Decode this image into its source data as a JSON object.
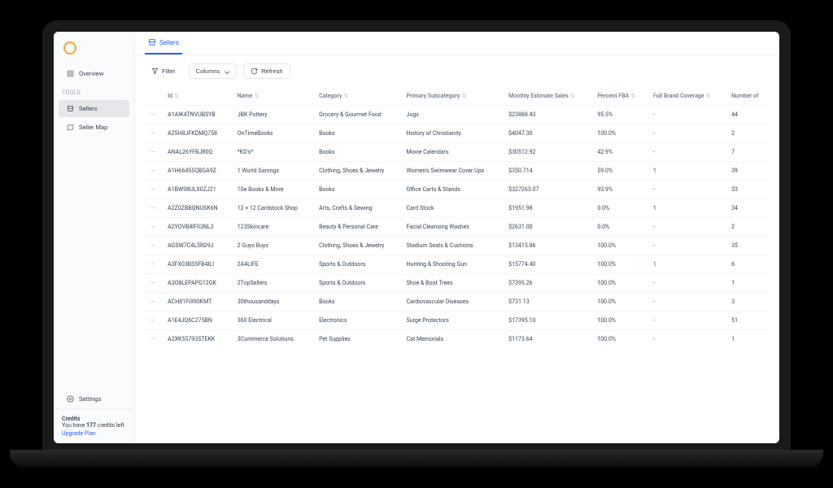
{
  "sidebar": {
    "overview": "Overview",
    "tools_label": "TOOLS",
    "sellers": "Sellers",
    "seller_map": "Seller Map",
    "settings": "Settings"
  },
  "credits": {
    "title": "Credits",
    "line_prefix": "You have ",
    "count": "177",
    "line_suffix": " credits left",
    "upgrade": "Upgrade Plan"
  },
  "tab": {
    "label": "Sellers"
  },
  "toolbar": {
    "filter": "Filter",
    "columns": "Columns",
    "refresh": "Refresh"
  },
  "columns": {
    "id": "Id",
    "name": "Name",
    "category": "Category",
    "subcat": "Primary Subcategory",
    "sales": "Monthly Estimate Sales",
    "fba": "Percent FBA",
    "brand": "Full Brand Coverage",
    "num": "Number of"
  },
  "rows": [
    {
      "id": "A1AIK4TNVUBSYB",
      "name": "JBK Pottery",
      "cat": "Grocery & Gourmet Food",
      "sub": "Jugs",
      "sales": "$23888.43",
      "fba": "95.5%",
      "brand": "-",
      "num": "44"
    },
    {
      "id": "A25H8JFKDMQ758",
      "name": "OnTimeBooks",
      "cat": "Books",
      "sub": "History of Christianity",
      "sales": "$4047.30",
      "fba": "100.0%",
      "brand": "-",
      "num": "2"
    },
    {
      "id": "ANAL26YFBJR0Q",
      "name": "*KD's*",
      "cat": "Books",
      "sub": "Movie Calendars",
      "sales": "$30512.92",
      "fba": "42.9%",
      "brand": "-",
      "num": "7"
    },
    {
      "id": "A1H66455QBGA9Z",
      "name": "1 World Sarongs",
      "cat": "Clothing, Shoes & Jewelry",
      "sub": "Women's Swimwear Cover Ups",
      "sales": "$350.714",
      "fba": "59.0%",
      "brand": "1",
      "num": "39"
    },
    {
      "id": "A1BW98ULX0ZJ21",
      "name": "10e Books & More",
      "cat": "Books",
      "sub": "Office Carts & Stands",
      "sales": "$327263.07",
      "fba": "93.9%",
      "brand": "-",
      "num": "33"
    },
    {
      "id": "A2Z0ZBBQNUSK6N",
      "name": "12 × 12 Cardstock Shop",
      "cat": "Arts, Crafts & Sewing",
      "sub": "Card Stock",
      "sales": "$1951.98",
      "fba": "0.0%",
      "brand": "1",
      "num": "34"
    },
    {
      "id": "A2YOVB4IF03NL3",
      "name": "123Skincare",
      "cat": "Beauty & Personal Care",
      "sub": "Facial Cleansing Washes",
      "sales": "$2631.00",
      "fba": "0.0%",
      "brand": "-",
      "num": "2"
    },
    {
      "id": "AGSW7C4L5RD9J",
      "name": "2 Guys Buys",
      "cat": "Clothing, Shoes & Jewelry",
      "sub": "Stadium Seats & Cushions",
      "sales": "$13415.86",
      "fba": "100.0%",
      "brand": "-",
      "num": "35"
    },
    {
      "id": "A3FX03BS5FB4ILI",
      "name": "2A4LIFE",
      "cat": "Sports & Outdoors",
      "sub": "Hunting & Shooting Gun",
      "sales": "$15774.40",
      "fba": "100.0%",
      "brand": "1",
      "num": "6",
      "brand_link": true
    },
    {
      "id": "A3O8LEPAPG12GK",
      "name": "2TopSellers",
      "cat": "Sports & Outdoors",
      "sub": "Shoe & Boot Trees",
      "sales": "$7395.26",
      "fba": "100.0%",
      "brand": "-",
      "num": "1"
    },
    {
      "id": "ACH81F0I90KMT",
      "name": "30thousanddays",
      "cat": "Books",
      "sub": "Cardiovascular Diseases",
      "sales": "$731.13",
      "fba": "100.0%",
      "brand": "-",
      "num": "3"
    },
    {
      "id": "A1E4JQ6C275BN",
      "name": "360 Electrical",
      "cat": "Electronics",
      "sub": "Surge Protectors",
      "sales": "$17395.10",
      "fba": "100.0%",
      "brand": "-",
      "num": "51"
    },
    {
      "id": "A2XK55793STEKK",
      "name": "3Commerce Solutions",
      "cat": "Pet Supplies",
      "sub": "Cat Memorials",
      "sales": "$1173.64",
      "fba": "100.0%",
      "brand": "-",
      "num": "1"
    }
  ]
}
